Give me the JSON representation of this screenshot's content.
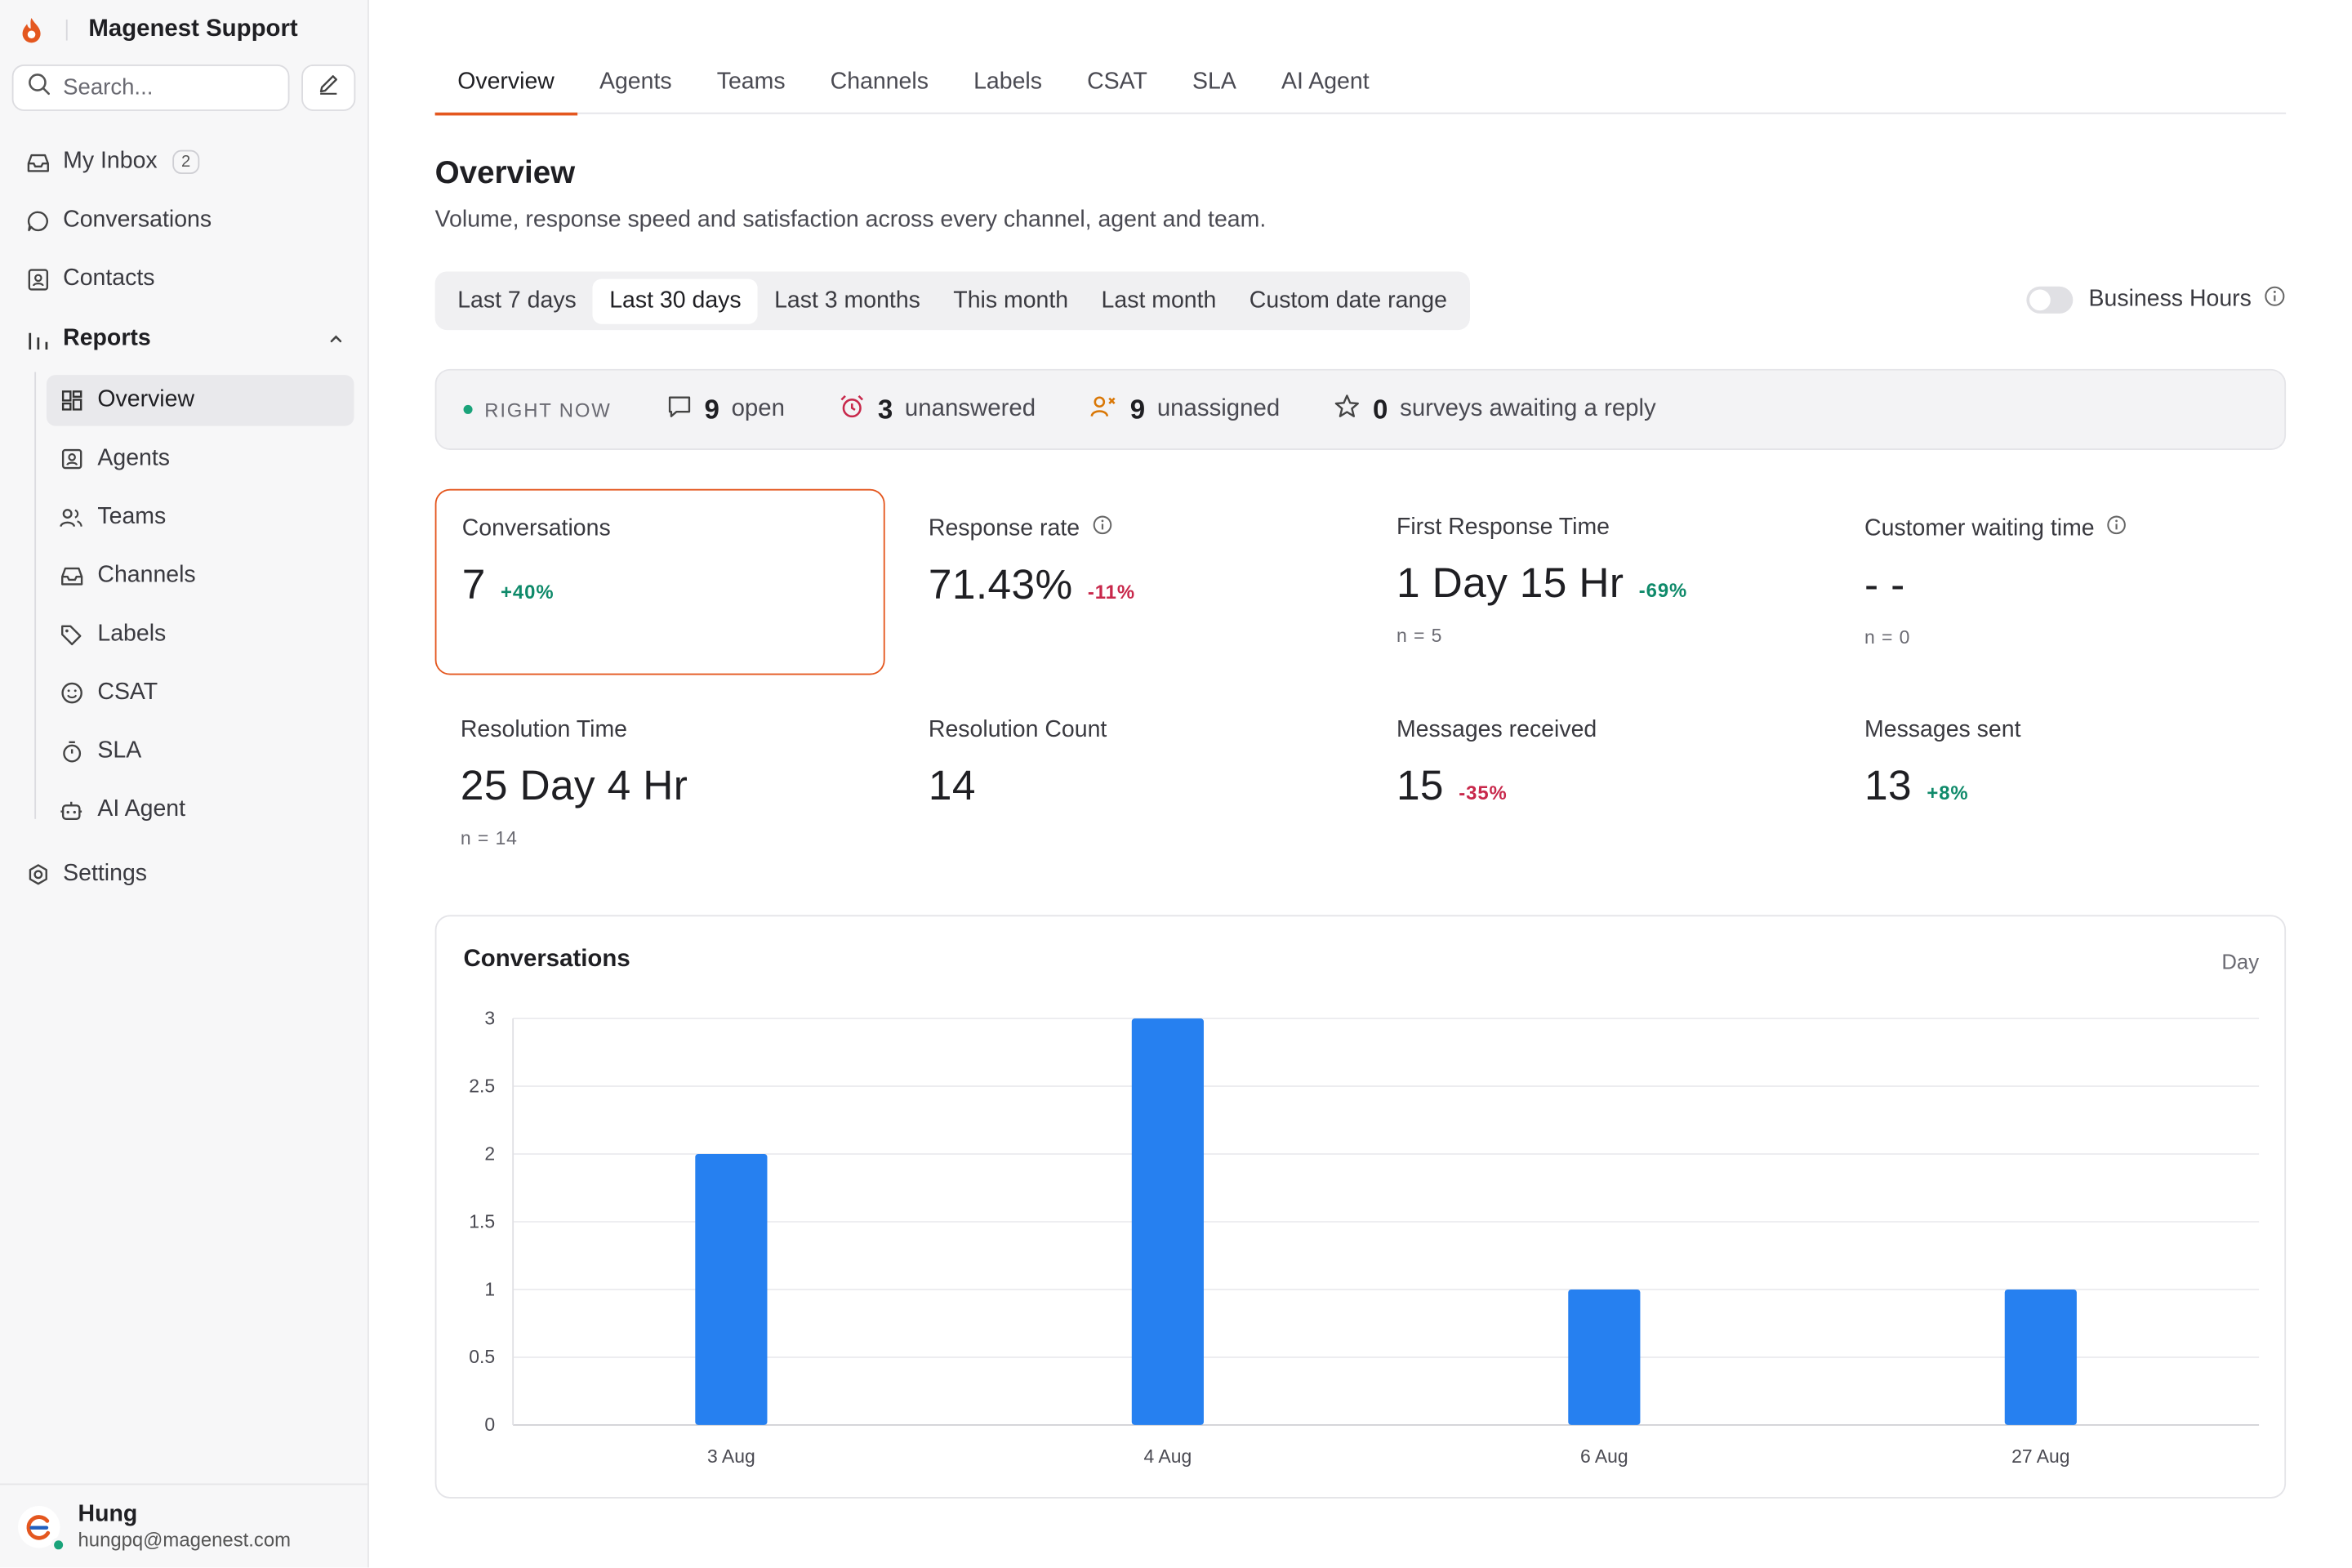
{
  "app": {
    "name": "Magenest Support"
  },
  "sidebar": {
    "search_placeholder": "Search...",
    "items": [
      {
        "label": "My Inbox",
        "badge": "2",
        "icon": "inbox-icon"
      },
      {
        "label": "Conversations",
        "icon": "chat-bubble-icon"
      },
      {
        "label": "Contacts",
        "icon": "contact-card-icon"
      },
      {
        "label": "Reports",
        "icon": "bar-chart-icon"
      },
      {
        "label": "Settings",
        "icon": "gear-icon"
      }
    ],
    "report_items": [
      {
        "label": "Overview",
        "icon": "grid-icon"
      },
      {
        "label": "Agents",
        "icon": "agent-icon"
      },
      {
        "label": "Teams",
        "icon": "team-icon"
      },
      {
        "label": "Channels",
        "icon": "inbox-icon"
      },
      {
        "label": "Labels",
        "icon": "tag-icon"
      },
      {
        "label": "CSAT",
        "icon": "smile-icon"
      },
      {
        "label": "SLA",
        "icon": "stopwatch-icon"
      },
      {
        "label": "AI Agent",
        "icon": "bot-icon"
      }
    ]
  },
  "user": {
    "name": "Hung",
    "email": "hungpq@magenest.com",
    "status": "online"
  },
  "tabs": [
    "Overview",
    "Agents",
    "Teams",
    "Channels",
    "Labels",
    "CSAT",
    "SLA",
    "AI Agent"
  ],
  "page": {
    "title": "Overview",
    "subtitle": "Volume, response speed and satisfaction across every channel, agent and team."
  },
  "date_ranges": [
    "Last 7 days",
    "Last 30 days",
    "Last 3 months",
    "This month",
    "Last month",
    "Custom date range"
  ],
  "selected_range": "Last 30 days",
  "business_hours": {
    "label": "Business Hours",
    "enabled": false
  },
  "right_now": {
    "label": "RIGHT NOW",
    "items": [
      {
        "value": "9",
        "label": "open",
        "icon": "chat-bubble-icon"
      },
      {
        "value": "3",
        "label": "unanswered",
        "icon": "alarm-clock-icon"
      },
      {
        "value": "9",
        "label": "unassigned",
        "icon": "user-x-icon"
      },
      {
        "value": "0",
        "label": "surveys awaiting a reply",
        "icon": "star-icon"
      }
    ]
  },
  "metrics": [
    {
      "label": "Conversations",
      "value": "7",
      "delta": "+40%",
      "trend": "up",
      "n": ""
    },
    {
      "label": "Response rate",
      "value": "71.43%",
      "delta": "-11%",
      "trend": "down",
      "n": "",
      "info": true
    },
    {
      "label": "First Response Time",
      "value": "1 Day 15 Hr",
      "delta": "-69%",
      "trend": "up",
      "n": "n = 5"
    },
    {
      "label": "Customer waiting time",
      "value": "- -",
      "delta": "",
      "trend": "",
      "n": "n = 0",
      "info": true
    },
    {
      "label": "Resolution Time",
      "value": "25 Day 4 Hr",
      "delta": "",
      "trend": "",
      "n": "n = 14"
    },
    {
      "label": "Resolution Count",
      "value": "14",
      "delta": "",
      "trend": "",
      "n": ""
    },
    {
      "label": "Messages received",
      "value": "15",
      "delta": "-35%",
      "trend": "down",
      "n": ""
    },
    {
      "label": "Messages sent",
      "value": "13",
      "delta": "+8%",
      "trend": "up",
      "n": ""
    }
  ],
  "chart_data": {
    "type": "bar",
    "title": "Conversations",
    "granularity": "Day",
    "categories": [
      "3 Aug",
      "4 Aug",
      "6 Aug",
      "27 Aug"
    ],
    "values": [
      2,
      3,
      1,
      1
    ],
    "ylim": [
      0,
      3
    ],
    "yticks": [
      "0",
      "0.5",
      "1",
      "1.5",
      "2",
      "2.5",
      "3"
    ],
    "grid": true,
    "bar_color": "#2680f0"
  },
  "colors": {
    "accent": "#e4571f",
    "positive": "#0f8a6a",
    "negative": "#c8284b",
    "live_dot": "#1aa37a"
  }
}
